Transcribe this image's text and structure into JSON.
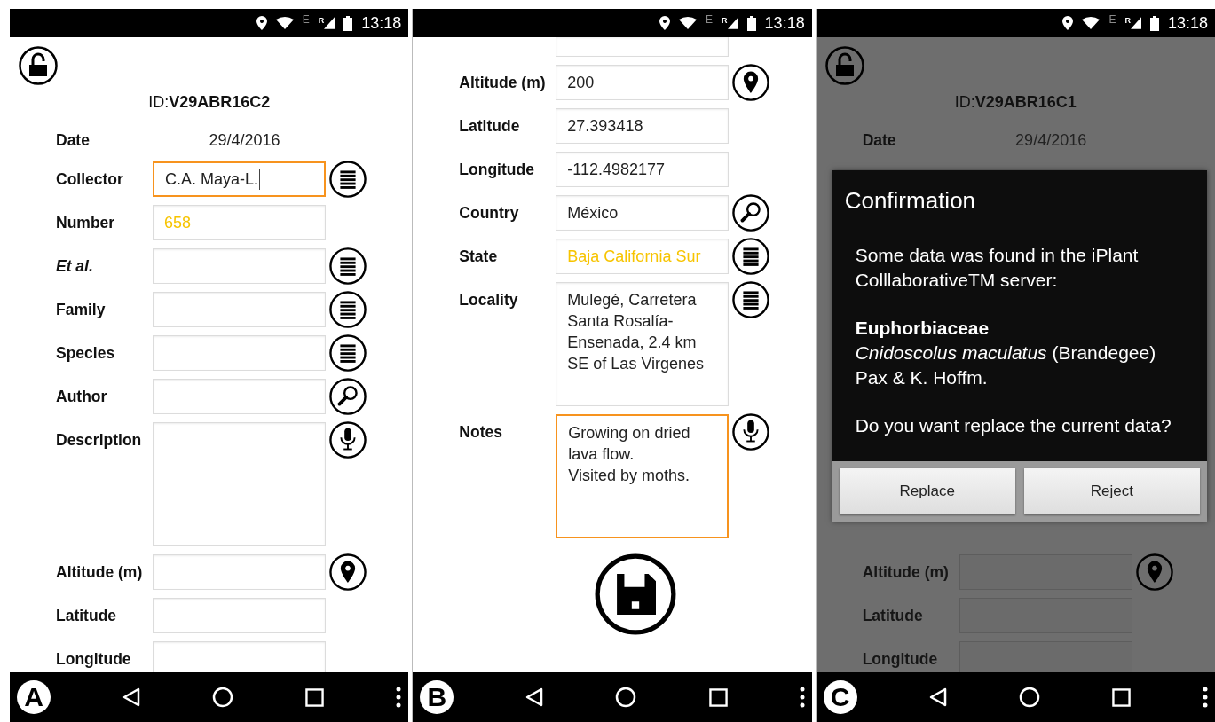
{
  "screens": [
    {
      "panel_label": "A",
      "status_bar": {
        "network": "E",
        "roaming": "R",
        "time": "13:18"
      },
      "dimmed": false,
      "header": {
        "id_prefix": "ID:",
        "id": "V29ABR16C2"
      },
      "date": {
        "label": "Date",
        "value": "29/4/2016"
      },
      "rows": [
        {
          "kind": "field",
          "label": "Collector",
          "value": "C.A. Maya-L.",
          "button": {
            "kind": "list"
          },
          "focused": true,
          "autofilled": false
        },
        {
          "kind": "field",
          "label": "Number",
          "value": "658",
          "focused": false,
          "autofilled": true
        },
        {
          "kind": "field",
          "label": "Et al.",
          "italic": true,
          "button": {
            "kind": "list"
          },
          "focused": false
        },
        {
          "kind": "field",
          "label": "Family",
          "button": {
            "kind": "list"
          },
          "focused": false
        },
        {
          "kind": "field",
          "label": "Species",
          "button": {
            "kind": "list"
          },
          "focused": false
        },
        {
          "kind": "field",
          "label": "Author",
          "button": {
            "kind": "search"
          },
          "focused": false
        },
        {
          "kind": "area",
          "label": "Description",
          "button": {
            "kind": "mic"
          },
          "focused": false
        },
        {
          "kind": "field",
          "label": "Altitude (m)",
          "button": {
            "kind": "pin"
          },
          "focused": false
        },
        {
          "kind": "field",
          "label": "Latitude",
          "focused": false
        },
        {
          "kind": "field",
          "label": "Longitude",
          "focused": false
        }
      ]
    },
    {
      "panel_label": "B",
      "status_bar": {
        "network": "E",
        "roaming": "R",
        "time": "13:18"
      },
      "dimmed": false,
      "rows": [
        {
          "kind": "partial"
        },
        {
          "kind": "field",
          "label": "Altitude (m)",
          "value": "200",
          "button": {
            "kind": "pin"
          },
          "focused": false,
          "autofilled": false
        },
        {
          "kind": "field",
          "label": "Latitude",
          "value": "27.393418",
          "focused": false,
          "autofilled": false
        },
        {
          "kind": "field",
          "label": "Longitude",
          "value": "-112.4982177",
          "focused": false,
          "autofilled": false
        },
        {
          "kind": "field",
          "label": "Country",
          "value": "México",
          "button": {
            "kind": "search"
          },
          "focused": false,
          "autofilled": false
        },
        {
          "kind": "field",
          "label": "State",
          "value": "Baja California Sur",
          "button": {
            "kind": "list"
          },
          "focused": false,
          "autofilled": true
        },
        {
          "kind": "area",
          "label": "Locality",
          "value": "Mulegé, Carretera Santa Rosalía-Ensenada, 2.4 km SE of Las Virgenes",
          "button": {
            "kind": "list"
          },
          "focused": false,
          "autofilled": false
        },
        {
          "kind": "area",
          "label": "Notes",
          "value": "Growing on dried lava flow.\nVisited by moths.",
          "button": {
            "kind": "mic"
          },
          "focused": true,
          "autofilled": false
        },
        {
          "kind": "save"
        }
      ]
    },
    {
      "panel_label": "C",
      "status_bar": {
        "network": "E",
        "roaming": "R",
        "time": "13:18"
      },
      "dimmed": true,
      "header": {
        "id_prefix": "ID:",
        "id": "V29ABR16C1"
      },
      "date": {
        "label": "Date",
        "value": "29/4/2016"
      },
      "dialog": {
        "title": "Confirmation",
        "message": "Some data was found in the iPlant ColllaborativeTM server:",
        "family": "Euphorbiaceae",
        "species": "*Cnidoscolus maculatus* (Brandegee) Pax & K. Hoffm.",
        "question": "Do you want replace the current data?",
        "buttons": [
          "Replace",
          "Reject"
        ]
      },
      "rows": [
        {
          "kind": "field",
          "label": "Altitude (m)",
          "button": {
            "kind": "pin"
          },
          "focused": false
        },
        {
          "kind": "field",
          "label": "Latitude",
          "focused": false
        },
        {
          "kind": "field",
          "label": "Longitude",
          "focused": false
        }
      ]
    }
  ]
}
